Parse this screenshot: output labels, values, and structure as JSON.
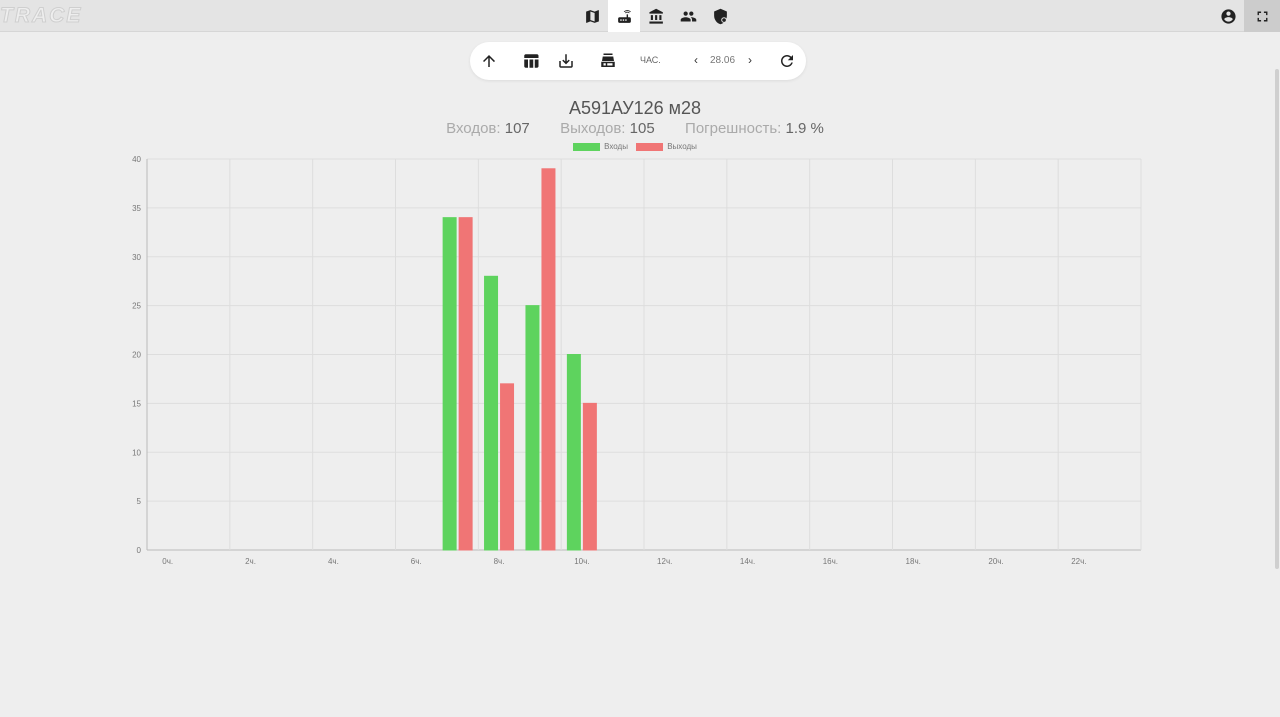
{
  "app": {
    "logo_text": "TRACE"
  },
  "nav": {
    "items": [
      {
        "name": "map-icon",
        "active": false
      },
      {
        "name": "router-icon",
        "active": true
      },
      {
        "name": "bank-icon",
        "active": false
      },
      {
        "name": "people-icon",
        "active": false
      },
      {
        "name": "shield-icon",
        "active": false
      }
    ]
  },
  "toolbar": {
    "period": "ЧАС.",
    "date": "28.06",
    "prev_symbol": "‹",
    "next_symbol": "›"
  },
  "header": {
    "title": "А591АУ126 м28",
    "entries_label": "Входов:",
    "entries_value": "107",
    "exits_label": "Выходов:",
    "exits_value": "105",
    "error_label": "Погрешность:",
    "error_value": "1.9 %"
  },
  "chart_data": {
    "type": "bar",
    "categories": [
      "0ч.",
      "1ч.",
      "2ч.",
      "3ч.",
      "4ч.",
      "5ч.",
      "6ч.",
      "7ч.",
      "8ч.",
      "9ч.",
      "10ч.",
      "11ч.",
      "12ч.",
      "13ч.",
      "14ч.",
      "15ч.",
      "16ч.",
      "17ч.",
      "18ч.",
      "19ч.",
      "20ч.",
      "21ч.",
      "22ч.",
      "23ч."
    ],
    "x_tick_labels": [
      "0ч.",
      "2ч.",
      "4ч.",
      "6ч.",
      "8ч.",
      "10ч.",
      "12ч.",
      "14ч.",
      "16ч.",
      "18ч.",
      "20ч.",
      "22ч."
    ],
    "series": [
      {
        "name": "Входы",
        "color": "#5ed35e",
        "values": [
          0,
          0,
          0,
          0,
          0,
          0,
          0,
          34,
          28,
          25,
          20,
          0,
          0,
          0,
          0,
          0,
          0,
          0,
          0,
          0,
          0,
          0,
          0,
          0
        ]
      },
      {
        "name": "Выходы",
        "color": "#f07575",
        "values": [
          0,
          0,
          0,
          0,
          0,
          0,
          0,
          34,
          17,
          39,
          15,
          0,
          0,
          0,
          0,
          0,
          0,
          0,
          0,
          0,
          0,
          0,
          0,
          0
        ]
      }
    ],
    "ylim": [
      0,
      40
    ],
    "y_ticks": [
      0,
      5,
      10,
      15,
      20,
      25,
      30,
      35,
      40
    ],
    "grid": true,
    "legend": "top-center"
  }
}
